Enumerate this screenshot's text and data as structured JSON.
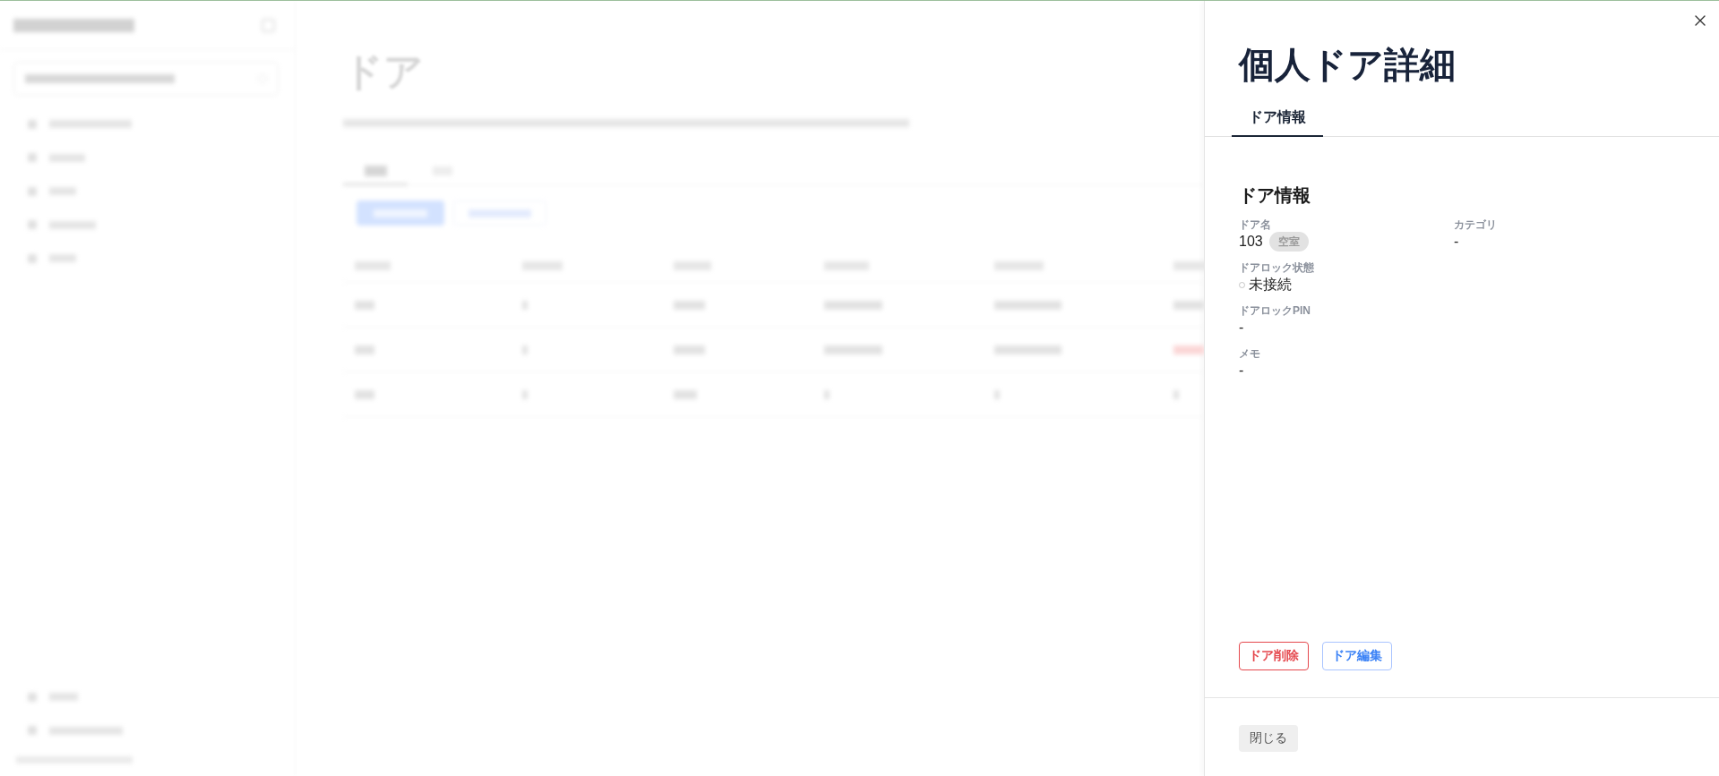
{
  "backdrop": {
    "heading": "ドア"
  },
  "drawer": {
    "title": "個人ドア詳細",
    "tabs": [
      {
        "label": "ドア情報",
        "selected": true
      }
    ],
    "section": {
      "title": "ドア情報",
      "rows": [
        [
          {
            "kind": "badge",
            "label": "ドア名",
            "value": "103",
            "badge": "空室"
          },
          {
            "kind": "text",
            "label": "カテゴリ",
            "value": "-"
          }
        ],
        [
          {
            "kind": "status",
            "label": "ドアロック状態",
            "value": "未接続",
            "connected": false
          }
        ],
        [
          {
            "kind": "text",
            "label": "ドアロックPIN",
            "value": "-"
          }
        ],
        [
          {
            "kind": "text",
            "label": "メモ",
            "value": "-"
          }
        ]
      ]
    },
    "actions": [
      {
        "kind": "danger",
        "label": "ドア削除"
      },
      {
        "kind": "primary",
        "label": "ドア編集"
      }
    ],
    "footer": {
      "close_label": "閉じる"
    }
  }
}
